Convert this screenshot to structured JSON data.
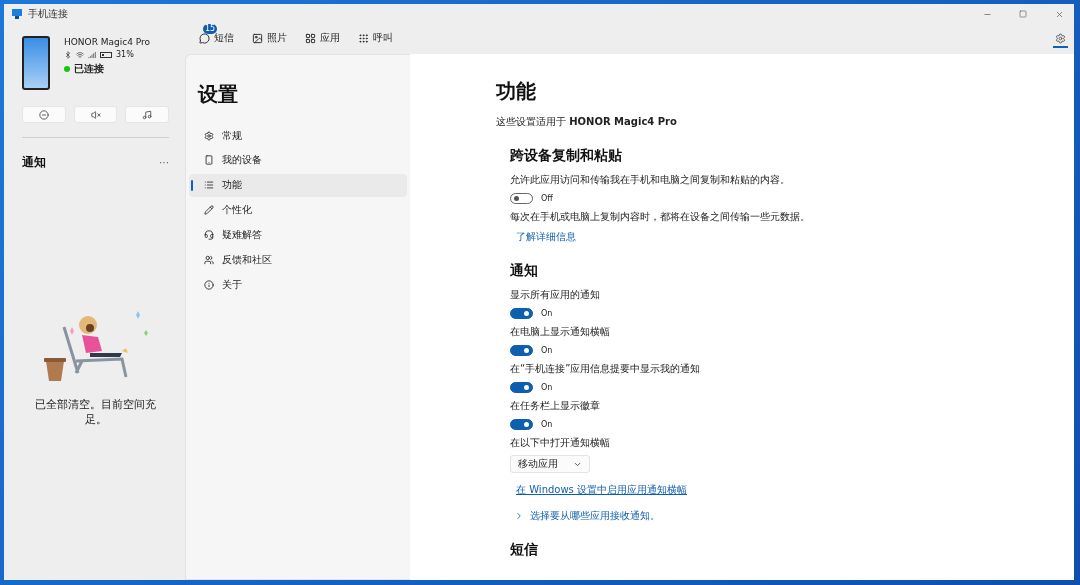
{
  "window": {
    "title": "手机连接"
  },
  "device": {
    "name": "HONOR Magic4 Pro",
    "battery": "31%",
    "status": "已连接",
    "connected": true
  },
  "quick_actions": [
    {
      "kind": "dnd"
    },
    {
      "kind": "mute"
    },
    {
      "kind": "media"
    }
  ],
  "notifications_panel": {
    "title": "通知",
    "more": "···",
    "empty_text": "已全部清空。目前空间充足。"
  },
  "tabs": [
    {
      "label": "短信",
      "badge": "15",
      "selected": false
    },
    {
      "label": "照片",
      "selected": false
    },
    {
      "label": "应用",
      "selected": false
    },
    {
      "label": "呼叫",
      "selected": false
    }
  ],
  "settings_button": {
    "selected": true
  },
  "settings_nav": {
    "title": "设置",
    "items": [
      {
        "label": "常规",
        "selected": false
      },
      {
        "label": "我的设备",
        "selected": false
      },
      {
        "label": "功能",
        "selected": true
      },
      {
        "label": "个性化",
        "selected": false
      },
      {
        "label": "疑难解答",
        "selected": false
      },
      {
        "label": "反馈和社区",
        "selected": false
      },
      {
        "label": "关于",
        "selected": false
      }
    ]
  },
  "content": {
    "title": "功能",
    "subtitle": "这些设置适用于 **HONOR Magic4 Pro**",
    "sections": [
      {
        "title": "跨设备复制和粘贴",
        "items": [
          {
            "kind": "text",
            "text": "允许此应用访问和传输我在手机和电脑之间复制和粘贴的内容。"
          },
          {
            "kind": "toggle",
            "on": false,
            "state_text": "Off"
          },
          {
            "kind": "text",
            "text": "每次在手机或电脑上复制内容时，都将在设备之间传输一些元数据。"
          },
          {
            "kind": "link",
            "text": "了解详细信息"
          }
        ]
      },
      {
        "title": "通知",
        "items": [
          {
            "kind": "text",
            "text": "显示所有应用的通知"
          },
          {
            "kind": "toggle",
            "on": true,
            "state_text": "On"
          },
          {
            "kind": "text",
            "text": "在电脑上显示通知横幅"
          },
          {
            "kind": "toggle",
            "on": true,
            "state_text": "On"
          },
          {
            "kind": "text",
            "text": "在“手机连接”应用信息提要中显示我的通知"
          },
          {
            "kind": "toggle",
            "on": true,
            "state_text": "On"
          },
          {
            "kind": "text",
            "text": "在任务栏上显示徽章"
          },
          {
            "kind": "toggle",
            "on": true,
            "state_text": "On"
          },
          {
            "kind": "text",
            "text": "在以下中打开通知横幅"
          },
          {
            "kind": "dropdown",
            "value": "移动应用"
          },
          {
            "kind": "underlined_link",
            "text": "在 Windows 设置中启用应用通知横幅"
          },
          {
            "kind": "expander",
            "text": "选择要从哪些应用接收通知。",
            "expanded": false
          }
        ]
      },
      {
        "title": "短信"
      }
    ]
  }
}
